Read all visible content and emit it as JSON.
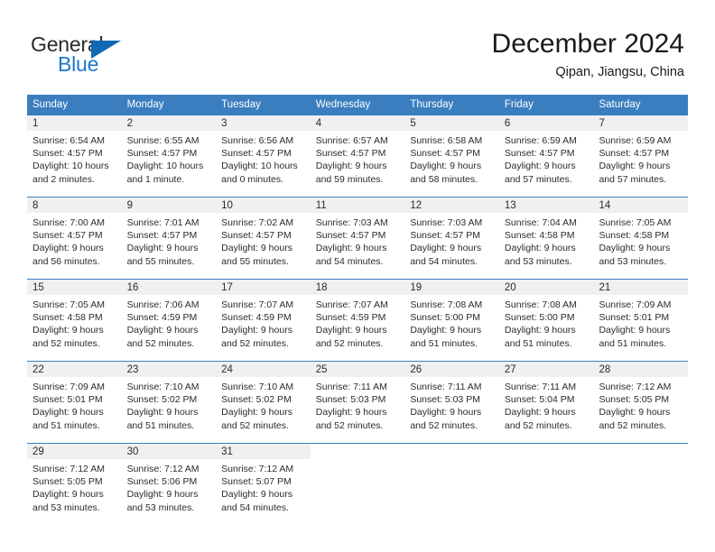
{
  "logo": {
    "word_top": "General",
    "word_bottom": "Blue",
    "triangle_color": "#1268b3",
    "blue_text_color": "#1b79c9"
  },
  "header": {
    "month_title": "December 2024",
    "location": "Qipan, Jiangsu, China"
  },
  "theme": {
    "header_blue": "#3a7ebf",
    "day_band_gray": "#f0f0f0",
    "text_dark": "#2b2b2b"
  },
  "calendar": {
    "weekdays": [
      "Sunday",
      "Monday",
      "Tuesday",
      "Wednesday",
      "Thursday",
      "Friday",
      "Saturday"
    ],
    "weeks": [
      [
        {
          "day": "1",
          "sunrise": "Sunrise: 6:54 AM",
          "sunset": "Sunset: 4:57 PM",
          "daylight": "Daylight: 10 hours and 2 minutes."
        },
        {
          "day": "2",
          "sunrise": "Sunrise: 6:55 AM",
          "sunset": "Sunset: 4:57 PM",
          "daylight": "Daylight: 10 hours and 1 minute."
        },
        {
          "day": "3",
          "sunrise": "Sunrise: 6:56 AM",
          "sunset": "Sunset: 4:57 PM",
          "daylight": "Daylight: 10 hours and 0 minutes."
        },
        {
          "day": "4",
          "sunrise": "Sunrise: 6:57 AM",
          "sunset": "Sunset: 4:57 PM",
          "daylight": "Daylight: 9 hours and 59 minutes."
        },
        {
          "day": "5",
          "sunrise": "Sunrise: 6:58 AM",
          "sunset": "Sunset: 4:57 PM",
          "daylight": "Daylight: 9 hours and 58 minutes."
        },
        {
          "day": "6",
          "sunrise": "Sunrise: 6:59 AM",
          "sunset": "Sunset: 4:57 PM",
          "daylight": "Daylight: 9 hours and 57 minutes."
        },
        {
          "day": "7",
          "sunrise": "Sunrise: 6:59 AM",
          "sunset": "Sunset: 4:57 PM",
          "daylight": "Daylight: 9 hours and 57 minutes."
        }
      ],
      [
        {
          "day": "8",
          "sunrise": "Sunrise: 7:00 AM",
          "sunset": "Sunset: 4:57 PM",
          "daylight": "Daylight: 9 hours and 56 minutes."
        },
        {
          "day": "9",
          "sunrise": "Sunrise: 7:01 AM",
          "sunset": "Sunset: 4:57 PM",
          "daylight": "Daylight: 9 hours and 55 minutes."
        },
        {
          "day": "10",
          "sunrise": "Sunrise: 7:02 AM",
          "sunset": "Sunset: 4:57 PM",
          "daylight": "Daylight: 9 hours and 55 minutes."
        },
        {
          "day": "11",
          "sunrise": "Sunrise: 7:03 AM",
          "sunset": "Sunset: 4:57 PM",
          "daylight": "Daylight: 9 hours and 54 minutes."
        },
        {
          "day": "12",
          "sunrise": "Sunrise: 7:03 AM",
          "sunset": "Sunset: 4:57 PM",
          "daylight": "Daylight: 9 hours and 54 minutes."
        },
        {
          "day": "13",
          "sunrise": "Sunrise: 7:04 AM",
          "sunset": "Sunset: 4:58 PM",
          "daylight": "Daylight: 9 hours and 53 minutes."
        },
        {
          "day": "14",
          "sunrise": "Sunrise: 7:05 AM",
          "sunset": "Sunset: 4:58 PM",
          "daylight": "Daylight: 9 hours and 53 minutes."
        }
      ],
      [
        {
          "day": "15",
          "sunrise": "Sunrise: 7:05 AM",
          "sunset": "Sunset: 4:58 PM",
          "daylight": "Daylight: 9 hours and 52 minutes."
        },
        {
          "day": "16",
          "sunrise": "Sunrise: 7:06 AM",
          "sunset": "Sunset: 4:59 PM",
          "daylight": "Daylight: 9 hours and 52 minutes."
        },
        {
          "day": "17",
          "sunrise": "Sunrise: 7:07 AM",
          "sunset": "Sunset: 4:59 PM",
          "daylight": "Daylight: 9 hours and 52 minutes."
        },
        {
          "day": "18",
          "sunrise": "Sunrise: 7:07 AM",
          "sunset": "Sunset: 4:59 PM",
          "daylight": "Daylight: 9 hours and 52 minutes."
        },
        {
          "day": "19",
          "sunrise": "Sunrise: 7:08 AM",
          "sunset": "Sunset: 5:00 PM",
          "daylight": "Daylight: 9 hours and 51 minutes."
        },
        {
          "day": "20",
          "sunrise": "Sunrise: 7:08 AM",
          "sunset": "Sunset: 5:00 PM",
          "daylight": "Daylight: 9 hours and 51 minutes."
        },
        {
          "day": "21",
          "sunrise": "Sunrise: 7:09 AM",
          "sunset": "Sunset: 5:01 PM",
          "daylight": "Daylight: 9 hours and 51 minutes."
        }
      ],
      [
        {
          "day": "22",
          "sunrise": "Sunrise: 7:09 AM",
          "sunset": "Sunset: 5:01 PM",
          "daylight": "Daylight: 9 hours and 51 minutes."
        },
        {
          "day": "23",
          "sunrise": "Sunrise: 7:10 AM",
          "sunset": "Sunset: 5:02 PM",
          "daylight": "Daylight: 9 hours and 51 minutes."
        },
        {
          "day": "24",
          "sunrise": "Sunrise: 7:10 AM",
          "sunset": "Sunset: 5:02 PM",
          "daylight": "Daylight: 9 hours and 52 minutes."
        },
        {
          "day": "25",
          "sunrise": "Sunrise: 7:11 AM",
          "sunset": "Sunset: 5:03 PM",
          "daylight": "Daylight: 9 hours and 52 minutes."
        },
        {
          "day": "26",
          "sunrise": "Sunrise: 7:11 AM",
          "sunset": "Sunset: 5:03 PM",
          "daylight": "Daylight: 9 hours and 52 minutes."
        },
        {
          "day": "27",
          "sunrise": "Sunrise: 7:11 AM",
          "sunset": "Sunset: 5:04 PM",
          "daylight": "Daylight: 9 hours and 52 minutes."
        },
        {
          "day": "28",
          "sunrise": "Sunrise: 7:12 AM",
          "sunset": "Sunset: 5:05 PM",
          "daylight": "Daylight: 9 hours and 52 minutes."
        }
      ],
      [
        {
          "day": "29",
          "sunrise": "Sunrise: 7:12 AM",
          "sunset": "Sunset: 5:05 PM",
          "daylight": "Daylight: 9 hours and 53 minutes."
        },
        {
          "day": "30",
          "sunrise": "Sunrise: 7:12 AM",
          "sunset": "Sunset: 5:06 PM",
          "daylight": "Daylight: 9 hours and 53 minutes."
        },
        {
          "day": "31",
          "sunrise": "Sunrise: 7:12 AM",
          "sunset": "Sunset: 5:07 PM",
          "daylight": "Daylight: 9 hours and 54 minutes."
        },
        {
          "day": "",
          "sunrise": "",
          "sunset": "",
          "daylight": ""
        },
        {
          "day": "",
          "sunrise": "",
          "sunset": "",
          "daylight": ""
        },
        {
          "day": "",
          "sunrise": "",
          "sunset": "",
          "daylight": ""
        },
        {
          "day": "",
          "sunrise": "",
          "sunset": "",
          "daylight": ""
        }
      ]
    ]
  }
}
